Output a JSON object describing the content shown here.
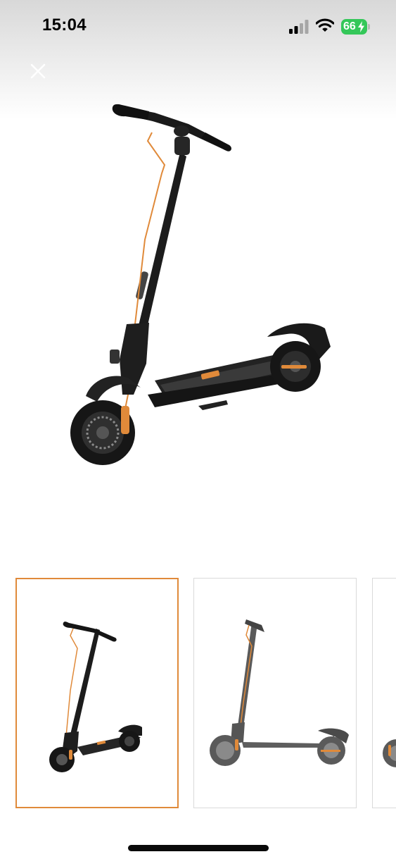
{
  "status_bar": {
    "time": "15:04",
    "battery_percent": "66",
    "battery_color": "#34c759",
    "signal_icon": "cellular-signal-icon",
    "wifi_icon": "wifi-icon",
    "charging_icon": "lightning-bolt-icon"
  },
  "viewer": {
    "close_icon": "close-icon",
    "selected_index": 1,
    "thumbnail_count_visible": 3
  },
  "colors": {
    "accent": "#e08a3a",
    "thumb_border": "#dadada"
  }
}
